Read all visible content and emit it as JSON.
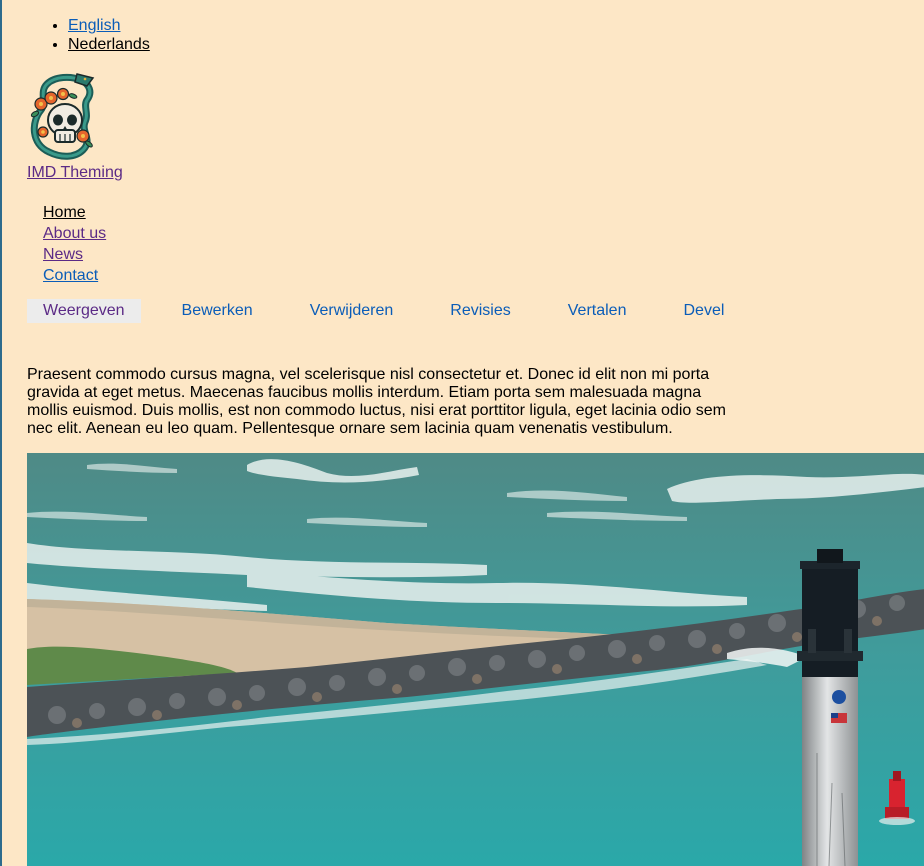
{
  "language_switcher": {
    "items": [
      {
        "label": "English"
      },
      {
        "label": "Nederlands"
      }
    ]
  },
  "branding": {
    "site_name": "IMD Theming",
    "logo_icon": "skull-snake-flowers-icon"
  },
  "main_menu": {
    "items": [
      {
        "label": "Home"
      },
      {
        "label": "About us"
      },
      {
        "label": "News"
      },
      {
        "label": "Contact"
      }
    ]
  },
  "tabs": {
    "items": [
      {
        "label": "Weergeven"
      },
      {
        "label": "Bewerken"
      },
      {
        "label": "Verwijderen"
      },
      {
        "label": "Revisies"
      },
      {
        "label": "Vertalen"
      },
      {
        "label": "Devel"
      }
    ],
    "active": "Weergeven"
  },
  "content": {
    "body": "Praesent commodo cursus magna, vel scelerisque nisl consectetur et. Donec id elit non mi porta gravida at eget metus. Maecenas faucibus mollis interdum. Etiam porta sem malesuada magna mollis euismod. Duis mollis, est non commodo luctus, nisi erat porttitor ligula, eget lacinia odio sem nec elit. Aenean eu leo quam. Pellentesque ornare sem lacinia quam venenatis vestibulum."
  },
  "colors": {
    "page_background": "#fde7c6",
    "link": "#0b5db8",
    "visited_link": "#5b2a86",
    "active_tab_background": "#ececec"
  }
}
